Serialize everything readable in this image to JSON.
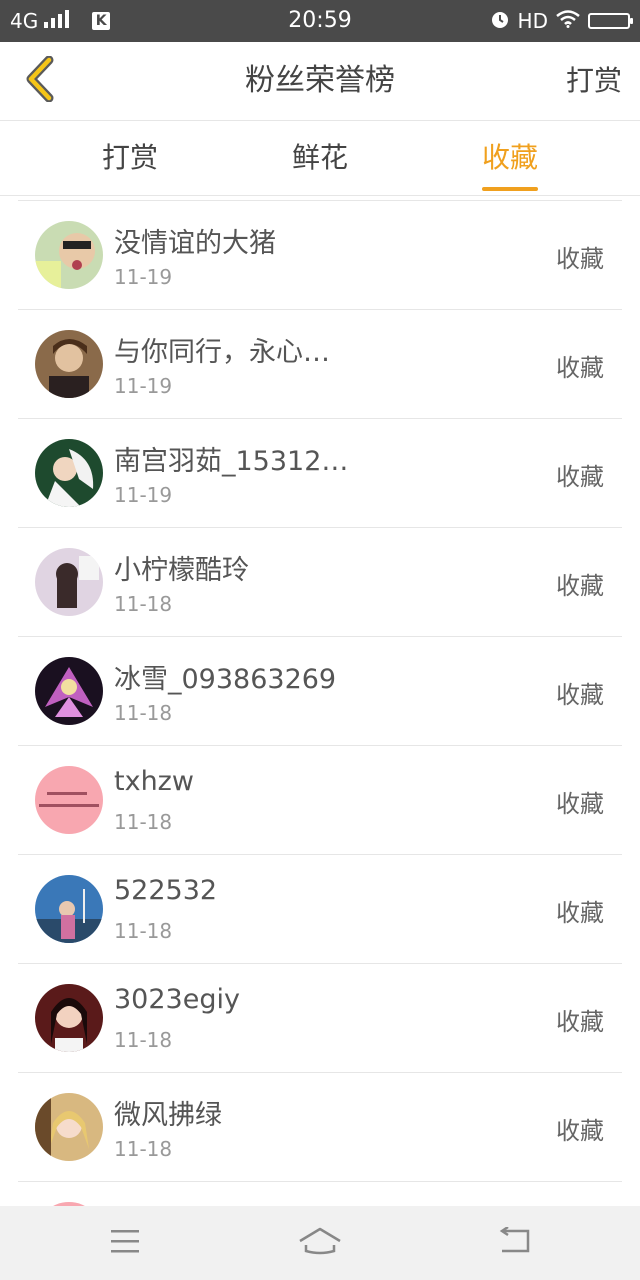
{
  "status_bar": {
    "network": "4G",
    "app_badge": "K",
    "time": "20:59",
    "hd": "HD"
  },
  "header": {
    "title": "粉丝荣誉榜",
    "action_label": "打赏"
  },
  "tabs": [
    {
      "label": "打赏",
      "active": false
    },
    {
      "label": "鲜花",
      "active": false
    },
    {
      "label": "收藏",
      "active": true
    }
  ],
  "fans": [
    {
      "name": "没情谊的大猪",
      "date": "11-19",
      "action": "收藏",
      "avatar_color": "#8fb57a"
    },
    {
      "name": "与你同行，永心…",
      "date": "11-19",
      "action": "收藏",
      "avatar_color": "#6b4a2e"
    },
    {
      "name": "南宫羽茹_15312…",
      "date": "11-19",
      "action": "收藏",
      "avatar_color": "#2e5a3a"
    },
    {
      "name": "小柠檬酷玲",
      "date": "11-18",
      "action": "收藏",
      "avatar_color": "#c9b4c8"
    },
    {
      "name": "冰雪_093863269",
      "date": "11-18",
      "action": "收藏",
      "avatar_color": "#7a3a6a"
    },
    {
      "name": "txhzw",
      "date": "11-18",
      "action": "收藏",
      "avatar_color": "#f7a6b0"
    },
    {
      "name": "522532",
      "date": "11-18",
      "action": "收藏",
      "avatar_color": "#3a6a9a"
    },
    {
      "name": "3023egiy",
      "date": "11-18",
      "action": "收藏",
      "avatar_color": "#6a2a2a"
    },
    {
      "name": "微风拂绿",
      "date": "11-18",
      "action": "收藏",
      "avatar_color": "#d9b27a"
    }
  ],
  "colors": {
    "accent": "#f0a01e",
    "status_bar": "#4a4a4a",
    "text": "#555555",
    "subtext": "#999999"
  },
  "icons": {
    "back": "back-chevron-icon",
    "nav_menu": "menu-icon",
    "nav_home": "home-icon",
    "nav_back": "return-icon"
  }
}
